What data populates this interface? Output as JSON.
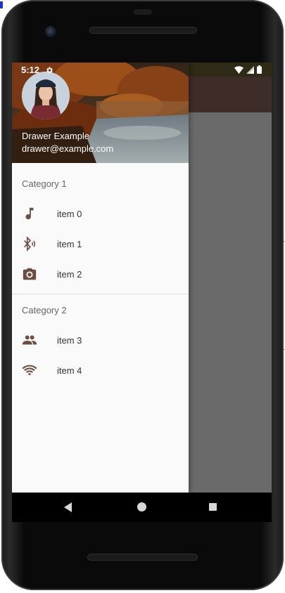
{
  "status_bar": {
    "time": "5:12",
    "settings_icon": "gear-icon",
    "wifi_icon": "wifi-icon",
    "signal_icon": "signal-icon",
    "battery_icon": "battery-icon"
  },
  "drawer": {
    "header": {
      "name": "Drawer Example",
      "email": "drawer@example.com"
    },
    "sections": [
      {
        "label": "Category 1",
        "items": [
          {
            "label": "item 0",
            "icon": "music-note-icon"
          },
          {
            "label": "item 1",
            "icon": "bluetooth-audio-icon"
          },
          {
            "label": "item 2",
            "icon": "camera-icon"
          }
        ]
      },
      {
        "label": "Category 2",
        "items": [
          {
            "label": "item 3",
            "icon": "people-icon"
          },
          {
            "label": "item 4",
            "icon": "wifi-icon"
          }
        ]
      }
    ]
  },
  "nav_bar": {
    "back": "back-icon",
    "home": "home-icon",
    "recents": "recents-icon"
  },
  "colors": {
    "icon": "#6d4c41",
    "header_text": "#ffffff",
    "app_bar": "#3e2c29",
    "scrim": "#6a6a6a",
    "drawer_bg": "#fafafa"
  }
}
